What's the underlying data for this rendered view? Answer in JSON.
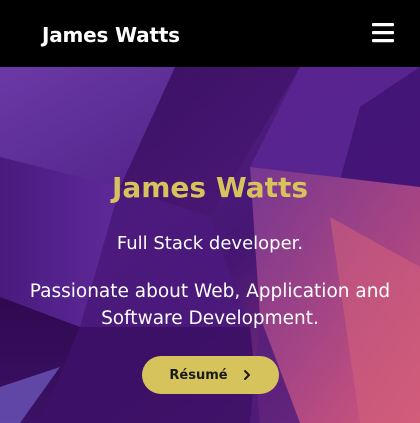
{
  "navbar": {
    "brand": "James Watts",
    "menu_icon": "hamburger-menu-icon"
  },
  "hero": {
    "name": "James Watts",
    "role": "Full Stack developer.",
    "tagline": "Passionate about Web, Application and Software Development.",
    "resume_button": {
      "label": "Résumé",
      "icon": "chevron-right-icon"
    }
  },
  "colors": {
    "navbar_bg": "#000000",
    "name_accent": "#d8c25c",
    "button_bg": "#d6c35c",
    "hero_primary": "#4a1878",
    "hero_highlight": "#c9537a"
  }
}
